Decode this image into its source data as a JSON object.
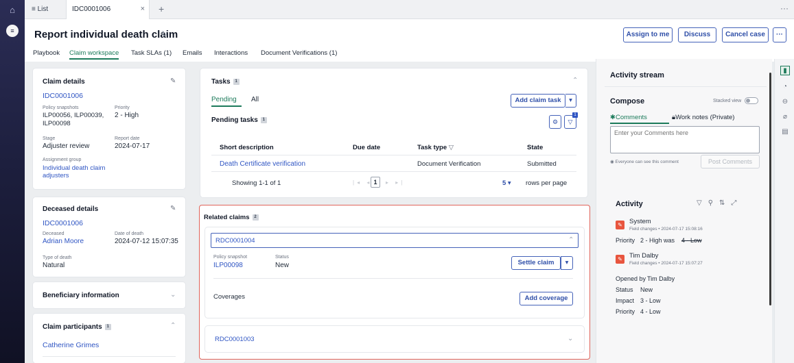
{
  "tabbar": {
    "list_label": "≡ List",
    "tab_title": "IDC0001006",
    "close": "×",
    "plus": "+",
    "more": "···"
  },
  "header": {
    "title": "Report individual death claim",
    "buttons": {
      "assign": "Assign to me",
      "discuss": "Discuss",
      "cancel": "Cancel case",
      "more": "···"
    },
    "subtabs": [
      "Playbook",
      "Claim workspace",
      "Task SLAs (1)",
      "Emails",
      "Interactions",
      "Document Verifications (1)"
    ]
  },
  "claim_details": {
    "heading": "Claim details",
    "number": "IDC0001006",
    "policy_label": "Policy snapshots",
    "policy_value": "ILP00056, ILP00039, ILP00098",
    "priority_label": "Priority",
    "priority_value": "2 - High",
    "stage_label": "Stage",
    "stage_value": "Adjuster review",
    "report_label": "Report date",
    "report_value": "2024-07-17",
    "group_label": "Assignment group",
    "group_value": "Individual death claim adjusters"
  },
  "deceased": {
    "heading": "Deceased details",
    "number": "IDC0001006",
    "deceased_label": "Deceased",
    "deceased_value": "Adrian Moore",
    "dod_label": "Date of death",
    "dod_value": "2024-07-12 15:07:35",
    "type_label": "Type of death",
    "type_value": "Natural"
  },
  "beneficiary": {
    "heading": "Beneficiary information"
  },
  "participants": {
    "heading": "Claim participants",
    "count": "1",
    "name": "Catherine Grimes"
  },
  "tasks": {
    "heading": "Tasks",
    "count": "1",
    "tab_pending": "Pending",
    "tab_all": "All",
    "add_button": "Add claim task",
    "pending_heading": "Pending tasks",
    "pending_count": "1",
    "filter_count": "1",
    "columns": [
      "Short description",
      "Due date",
      "Task type",
      "State"
    ],
    "rows": [
      {
        "description": "Death Certificate verification",
        "due": "",
        "type": "Document Verification",
        "state": "Submitted"
      }
    ],
    "showing": "Showing 1-1 of 1",
    "page": "1",
    "rows_per_page_value": "5",
    "rows_per_page_label": "rows per page"
  },
  "related": {
    "heading": "Related claims",
    "count": "2",
    "claims": [
      {
        "number": "RDC0001004",
        "policy_label": "Policy snapshot",
        "policy_value": "ILP00098",
        "status_label": "Status",
        "status_value": "New",
        "settle_button": "Settle claim",
        "coverages_label": "Coverages",
        "add_coverage": "Add coverage"
      },
      {
        "number": "RDC0001003"
      }
    ]
  },
  "activity_stream": {
    "heading": "Activity stream",
    "compose": "Compose",
    "stacked_view": "Stacked view",
    "tab_comments": "Comments",
    "tab_worknotes": "Work notes (Private)",
    "comment_placeholder": "Enter your Comments here",
    "visibility_note": "Everyone can see this comment",
    "post_button": "Post Comments",
    "activity_heading": "Activity",
    "entries": [
      {
        "author": "System",
        "meta": "Field changes • 2024-07-17 15:08:16",
        "changes": [
          {
            "field": "Priority",
            "value": "2 - High was",
            "old": "4 - Low"
          }
        ]
      },
      {
        "author": "Tim Dalby",
        "meta": "Field changes • 2024-07-17 15:07:27",
        "opened_by_label": "Opened by",
        "opened_by_value": "Tim Dalby",
        "changes": [
          {
            "field": "Status",
            "value": "New"
          },
          {
            "field": "Impact",
            "value": "3 - Low"
          },
          {
            "field": "Priority",
            "value": "4 - Low"
          }
        ]
      }
    ]
  },
  "colors": {
    "accent": "#2f4fa8",
    "link": "#2f55c3",
    "active_tab": "#1b7a5a",
    "highlight_border": "#e0635a",
    "edit_badge": "#e8553e"
  }
}
